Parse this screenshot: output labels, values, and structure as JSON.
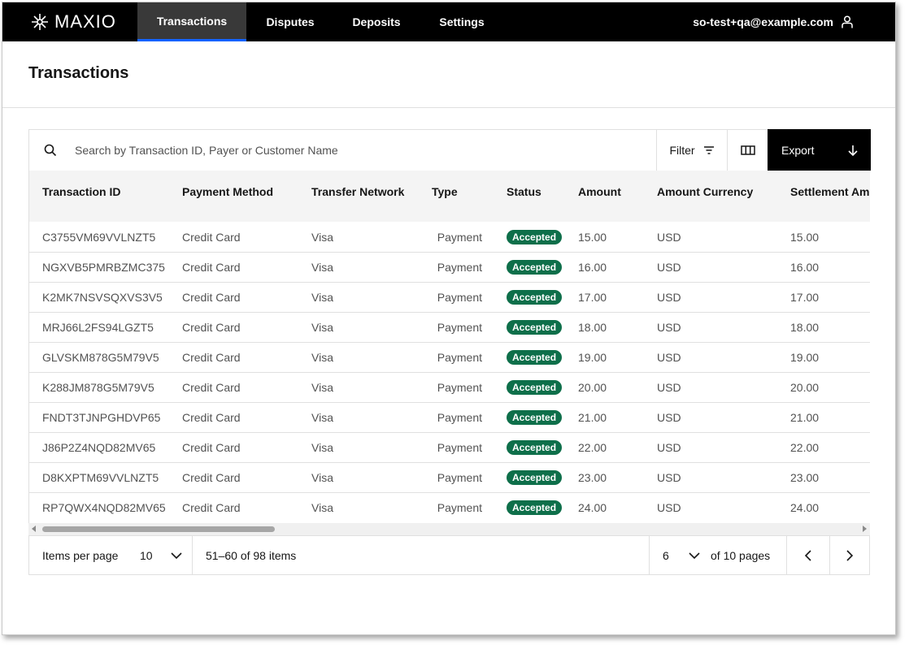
{
  "brand": {
    "name": "MAXIO"
  },
  "nav": {
    "tabs": [
      {
        "label": "Transactions",
        "active": true
      },
      {
        "label": "Disputes",
        "active": false
      },
      {
        "label": "Deposits",
        "active": false
      },
      {
        "label": "Settings",
        "active": false
      }
    ],
    "user_email": "so-test+qa@example.com"
  },
  "page": {
    "title": "Transactions"
  },
  "toolbar": {
    "search_placeholder": "Search by Transaction ID, Payer or Customer Name",
    "filter_label": "Filter",
    "export_label": "Export"
  },
  "table": {
    "columns": [
      "Transaction ID",
      "Payment Method",
      "Transfer Network",
      "Type",
      "Status",
      "Amount",
      "Amount Currency",
      "Settlement Amount"
    ],
    "rows": [
      {
        "id": "C3755VM69VVLNZT5",
        "method": "Credit Card",
        "network": "Visa",
        "type": "Payment",
        "status": "Accepted",
        "amount": "15.00",
        "currency": "USD",
        "settlement": "15.00"
      },
      {
        "id": "NGXVB5PMRBZMC375",
        "method": "Credit Card",
        "network": "Visa",
        "type": "Payment",
        "status": "Accepted",
        "amount": "16.00",
        "currency": "USD",
        "settlement": "16.00"
      },
      {
        "id": "K2MK7NSVSQXVS3V5",
        "method": "Credit Card",
        "network": "Visa",
        "type": "Payment",
        "status": "Accepted",
        "amount": "17.00",
        "currency": "USD",
        "settlement": "17.00"
      },
      {
        "id": "MRJ66L2FS94LGZT5",
        "method": "Credit Card",
        "network": "Visa",
        "type": "Payment",
        "status": "Accepted",
        "amount": "18.00",
        "currency": "USD",
        "settlement": "18.00"
      },
      {
        "id": "GLVSKM878G5M79V5",
        "method": "Credit Card",
        "network": "Visa",
        "type": "Payment",
        "status": "Accepted",
        "amount": "19.00",
        "currency": "USD",
        "settlement": "19.00"
      },
      {
        "id": "K288JM878G5M79V5",
        "method": "Credit Card",
        "network": "Visa",
        "type": "Payment",
        "status": "Accepted",
        "amount": "20.00",
        "currency": "USD",
        "settlement": "20.00"
      },
      {
        "id": "FNDT3TJNPGHDVP65",
        "method": "Credit Card",
        "network": "Visa",
        "type": "Payment",
        "status": "Accepted",
        "amount": "21.00",
        "currency": "USD",
        "settlement": "21.00"
      },
      {
        "id": "J86P2Z4NQD82MV65",
        "method": "Credit Card",
        "network": "Visa",
        "type": "Payment",
        "status": "Accepted",
        "amount": "22.00",
        "currency": "USD",
        "settlement": "22.00"
      },
      {
        "id": "D8KXPTM69VVLNZT5",
        "method": "Credit Card",
        "network": "Visa",
        "type": "Payment",
        "status": "Accepted",
        "amount": "23.00",
        "currency": "USD",
        "settlement": "23.00"
      },
      {
        "id": "RP7QWX4NQD82MV65",
        "method": "Credit Card",
        "network": "Visa",
        "type": "Payment",
        "status": "Accepted",
        "amount": "24.00",
        "currency": "USD",
        "settlement": "24.00"
      }
    ]
  },
  "pagination": {
    "items_per_page_label": "Items per page",
    "items_per_page": "10",
    "range_text": "51–60 of 98 items",
    "current_page": "6",
    "of_pages_text": "of 10 pages"
  },
  "colors": {
    "accepted_badge": "#0e6f4a",
    "nav_bg": "#000000",
    "active_tab_underline": "#0f62fe"
  }
}
